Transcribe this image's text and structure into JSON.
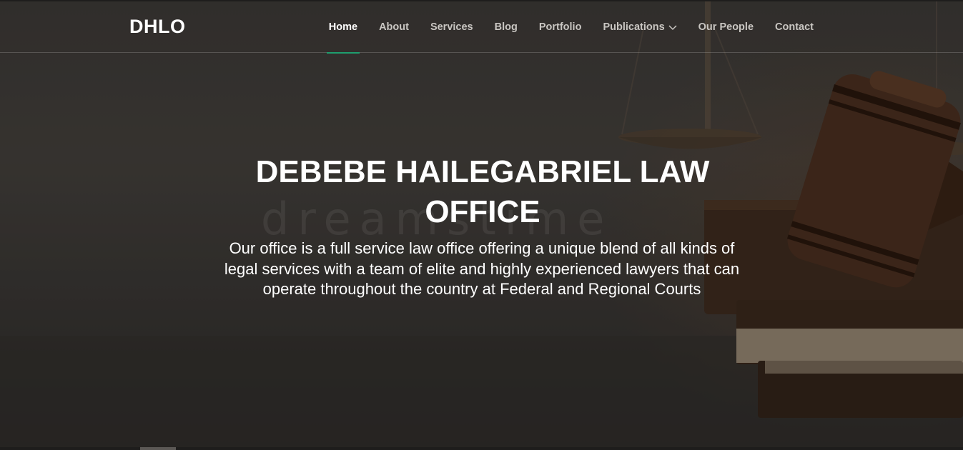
{
  "brand": {
    "name": "DHLO"
  },
  "nav": {
    "items": [
      {
        "label": "Home",
        "active": true
      },
      {
        "label": "About"
      },
      {
        "label": "Services"
      },
      {
        "label": "Blog"
      },
      {
        "label": "Portfolio"
      },
      {
        "label": "Publications",
        "has_dropdown": true
      },
      {
        "label": "Our People"
      },
      {
        "label": "Contact"
      }
    ],
    "active_color": "#1e9e6e"
  },
  "hero": {
    "title": "DEBEBE HAILEGABRIEL LAW OFFICE",
    "description": "Our office is a full service law office offering a unique blend of all kinds of legal services with a team of elite and highly experienced lawyers that can operate throughout the country at Federal and Regional Courts",
    "watermark": "dreamstime"
  },
  "icons": {
    "dropdown": "chevron-down-icon",
    "background": "gavel-and-scales-image"
  }
}
